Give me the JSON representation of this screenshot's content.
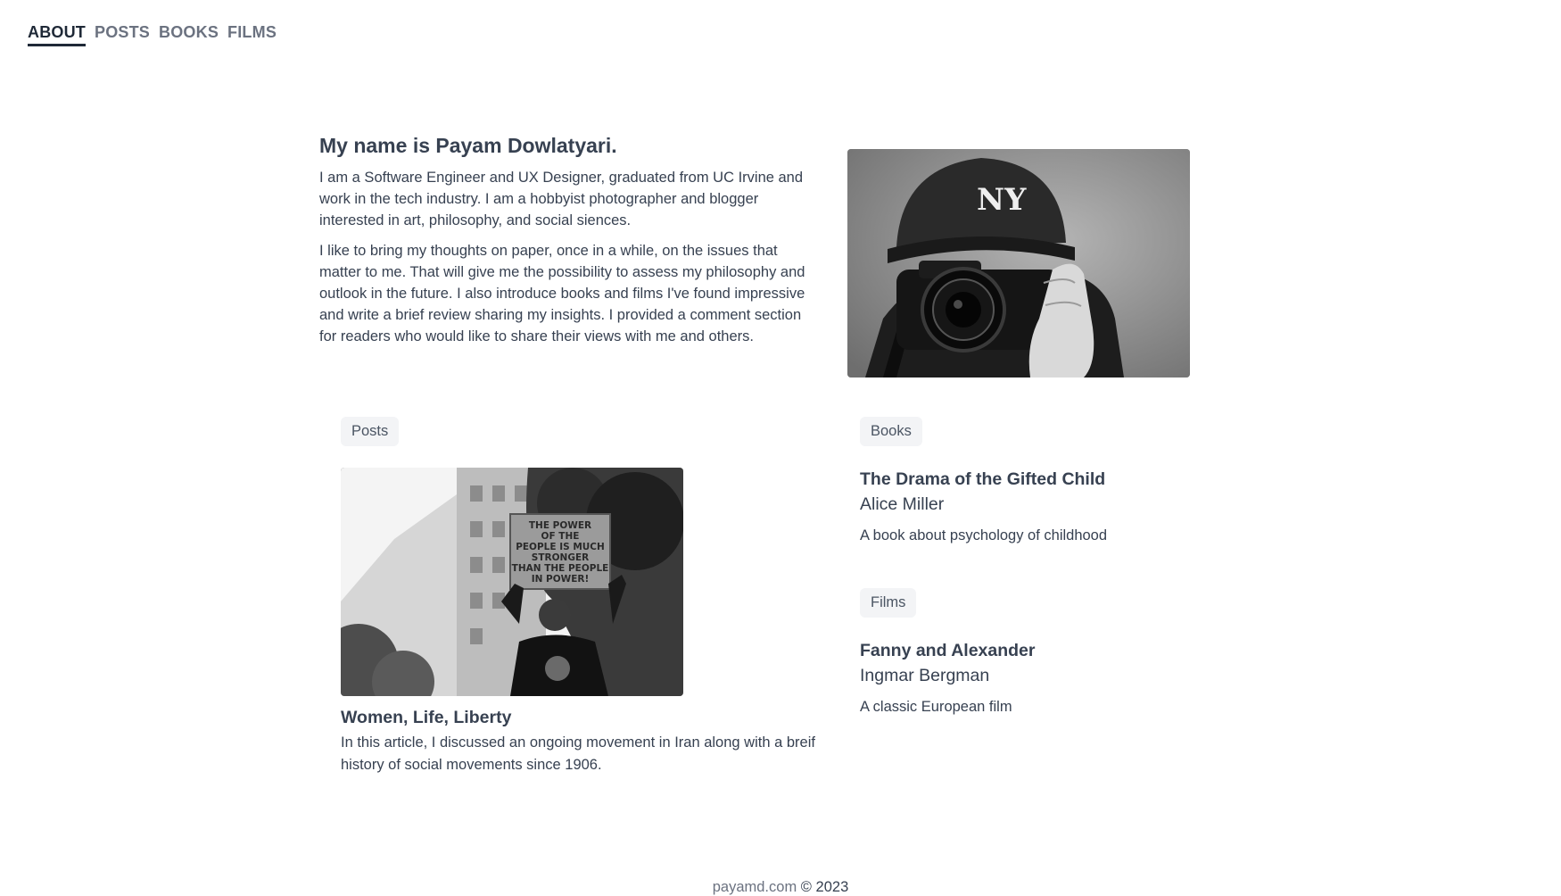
{
  "nav": {
    "items": [
      {
        "label": "ABOUT",
        "active": true
      },
      {
        "label": "POSTS",
        "active": false
      },
      {
        "label": "BOOKS",
        "active": false
      },
      {
        "label": "FILMS",
        "active": false
      }
    ]
  },
  "about": {
    "heading": "My name is Payam Dowlatyari.",
    "paragraph1": "I am a Software Engineer and UX Designer, graduated from UC Irvine and work in the tech industry. I am a hobbyist photographer and blogger interested in art, philosophy, and social siences.",
    "paragraph2": "I like to bring my thoughts on paper, once in a while, on the issues that matter to me. That will give me the possibility to assess my philosophy and outlook in the future. I also introduce books and films I've found impressive and write a brief review sharing my insights. I provided a comment section for readers who would like to share their views with me and others."
  },
  "posts": {
    "tag": "Posts",
    "featured": {
      "title": "Women, Life, Liberty",
      "summary": "In this article, I discussed an ongoing movement in Iran along with a breif history of social movements since 1906.",
      "sign_text": [
        "THE POWER",
        "OF THE",
        "PEOPLE IS MUCH",
        "STRONGER",
        "THAN THE PEOPLE",
        "IN POWER!"
      ]
    }
  },
  "books": {
    "tag": "Books",
    "featured": {
      "title": "The Drama of the Gifted Child",
      "author": "Alice Miller",
      "description": "A book about psychology of childhood"
    }
  },
  "films": {
    "tag": "Films",
    "featured": {
      "title": "Fanny and Alexander",
      "author": "Ingmar Bergman",
      "description": "A classic European film"
    }
  },
  "footer": {
    "site": "payamd.com",
    "copyright": "© 2023"
  },
  "colors": {
    "text": "#374151",
    "muted": "#6b7280",
    "tag_bg": "#f3f4f6"
  }
}
